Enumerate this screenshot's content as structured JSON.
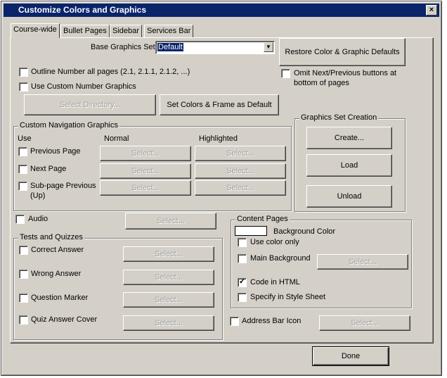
{
  "window": {
    "title": "Customize Colors and Graphics",
    "close_label": "×"
  },
  "tabs": [
    {
      "label": "Course-wide"
    },
    {
      "label": "Bullet Pages"
    },
    {
      "label": "Sidebar"
    },
    {
      "label": "Services Bar"
    }
  ],
  "base_graphics": {
    "label": "Base Graphics Set",
    "value": "Default"
  },
  "restore_button": "Restore Color & Graphic Defaults",
  "outline_numbers_label": "Outline Number all pages (2.1, 2.1.1, 2.1.2, ...)",
  "custom_number_label": "Use Custom Number Graphics",
  "omit_next_prev_label_1": "Omit Next/Previous buttons at",
  "omit_next_prev_label_2": "bottom of pages",
  "select_directory_button": "Select Directory...",
  "set_default_button": "Set Colors & Frame as Default",
  "nav_graphics": {
    "title": "Custom Navigation Graphics",
    "col_use": "Use",
    "col_normal": "Normal",
    "col_highlighted": "Highlighted",
    "rows": [
      {
        "label": "Previous Page"
      },
      {
        "label": "Next Page"
      },
      {
        "label": "Sub-page Previous",
        "label2": "(Up)"
      }
    ],
    "select_label": "Select..."
  },
  "graphics_set": {
    "title": "Graphics Set Creation",
    "create": "Create...",
    "load": "Load",
    "unload": "Unload"
  },
  "audio_label": "Audio",
  "tests": {
    "title": "Tests and Quizzes",
    "rows": [
      {
        "label": "Correct Answer"
      },
      {
        "label": "Wrong Answer"
      },
      {
        "label": "Question Marker"
      },
      {
        "label": "Quiz Answer Cover"
      }
    ]
  },
  "content_pages": {
    "title": "Content Pages",
    "bg_color_label": "Background Color",
    "use_color_only": "Use color only",
    "main_background": "Main Background",
    "code_in_html": "Code in HTML",
    "style_sheet": "Specify in Style Sheet"
  },
  "address_bar_label": "Address Bar Icon",
  "done_button": "Done"
}
